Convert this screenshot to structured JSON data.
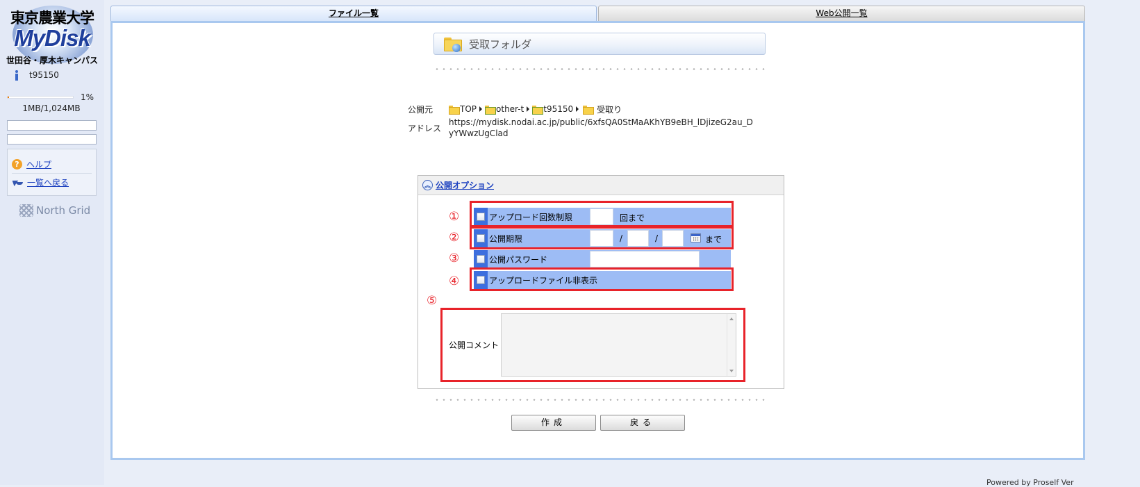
{
  "sidebar": {
    "logo": {
      "university": "東京農業大学",
      "product": "MyDisk",
      "campus": "世田谷・厚木キャンパス"
    },
    "user": {
      "icon": "info-icon",
      "name": "t95150"
    },
    "quota": {
      "percent_label": "1%",
      "percent": 1,
      "usage": "1MB/1,024MB",
      "bar_color": "#f07a00"
    },
    "links": [
      {
        "icon": "help-icon",
        "label": "ヘルプ"
      },
      {
        "icon": "back-arrow-icon",
        "label": "一覧へ戻る"
      }
    ],
    "vendor": "North Grid"
  },
  "tabs": [
    {
      "label": "ファイル一覧",
      "active": true
    },
    {
      "label": "Web公開一覧",
      "active": false
    }
  ],
  "folder": {
    "icon": "web-folder-icon",
    "title": "受取フォルダ"
  },
  "publish_info": {
    "source_label": "公開元",
    "breadcrumb": [
      "TOP",
      "other-t",
      "t95150",
      "受取り"
    ],
    "address_label": "アドレス",
    "address": "https://mydisk.nodai.ac.jp/public/6xfsQA0StMaAKhYB9eBH_lDjizeG2au_DyYWwzUgClad"
  },
  "options": {
    "title": "公開オプション",
    "download_limit": {
      "marker": "①",
      "label": "アップロード回数制限",
      "value": "",
      "suffix": "回まで"
    },
    "expiry": {
      "marker": "②",
      "label": "公開期限",
      "sep1": "/",
      "sep2": "/",
      "suffix": "まで"
    },
    "password": {
      "marker": "③",
      "label": "公開パスワード",
      "value": ""
    },
    "hide_files": {
      "marker": "④",
      "label": "アップロードファイル非表示"
    },
    "comment": {
      "marker": "⑤",
      "label": "公開コメント",
      "value": ""
    }
  },
  "buttons": {
    "create": "作成",
    "back": "戻る"
  },
  "footer": {
    "text": "Powered by Proself Ver"
  },
  "colors": {
    "accent_red": "#e8232a",
    "option_row": "#9dbcf5",
    "option_checkbox_bg": "#3d6fde",
    "panel_border": "#a9c8ef"
  }
}
